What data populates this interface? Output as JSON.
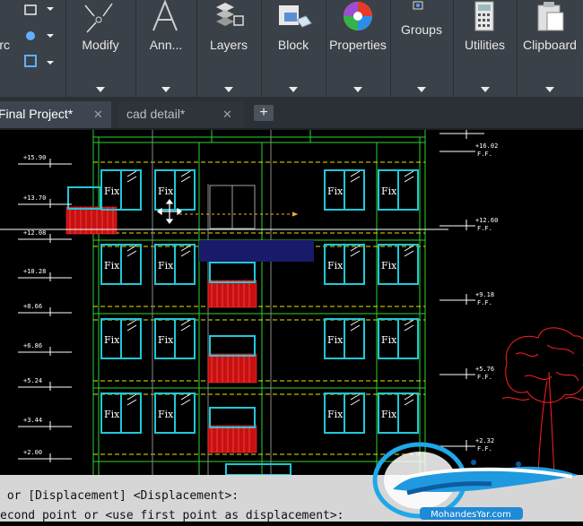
{
  "ribbon": {
    "panels": [
      {
        "label": "Arc"
      },
      {
        "label": "Modify"
      },
      {
        "label": "Ann..."
      },
      {
        "label": "Layers"
      },
      {
        "label": "Block"
      },
      {
        "label": "Properties"
      },
      {
        "label": "Groups"
      },
      {
        "label": "Utilities"
      },
      {
        "label": "Clipboard"
      }
    ]
  },
  "tabs": [
    {
      "label": "Final Project*"
    },
    {
      "label": "cad detail*"
    }
  ],
  "add_tab": "+",
  "drawing": {
    "window_label": "Fix",
    "level_marks_left": [
      "+15.90",
      "+13.70",
      "+12.08",
      "+10.28",
      "+8.66",
      "+6.86",
      "+5.24",
      "+3.44",
      "+2.00"
    ],
    "level_marks_right": [
      "+16.02",
      "+12.60",
      "+9.18",
      "+5.76",
      "+2.32"
    ],
    "level_sublabel": "F.F."
  },
  "command": {
    "line1": " or [Displacement] <Displacement>:",
    "line2": "econd point or <use first point as displacement>:"
  },
  "watermark": {
    "site": "MohandesYar.com"
  },
  "colors": {
    "ribbon_bg": "#3b4148",
    "cad_green": "#2bd42b",
    "cad_cyan": "#1fc8d8",
    "cad_red": "#e01010",
    "cad_yellow": "#e6e600",
    "navy": "#1a1a6a"
  }
}
